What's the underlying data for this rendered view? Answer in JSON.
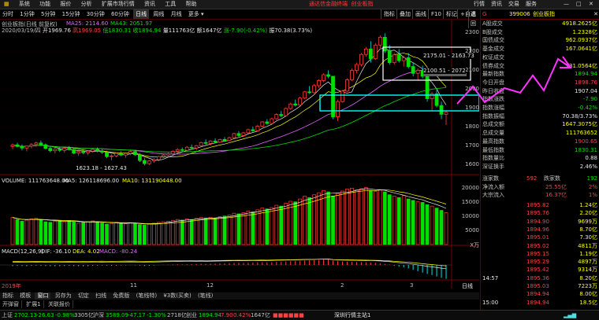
{
  "menu": {
    "items": [
      "系统",
      "功能",
      "报价",
      "分析",
      "扩展市场行情",
      "资讯",
      "工具",
      "帮助"
    ],
    "center_links": [
      "通达信金融终端",
      "创业板指"
    ],
    "window_buttons": [
      "行",
      "情",
      "资",
      "讯",
      "交",
      "易",
      "服",
      "务"
    ]
  },
  "toolbar": {
    "timeframes": [
      "分时",
      "1分钟",
      "5分钟",
      "15分钟",
      "30分钟",
      "60分钟",
      "日线",
      "周线",
      "月线",
      "更多"
    ],
    "active": "日线",
    "right_buttons": [
      "指标",
      "叠加",
      "画线",
      "F10",
      "标记",
      "+自选",
      "返回"
    ]
  },
  "chart": {
    "title_line": "创业板指(日线 前复权)",
    "ma_line": [
      {
        "text": "MA25: 2114.60",
        "color": "#e066ff"
      },
      {
        "text": "MA43: 2051.97",
        "color": "#00e000"
      }
    ],
    "date_line": "2020/03/19/四",
    "ohlc_line": [
      {
        "text": "开1969.76",
        "color": "#e6e6e6"
      },
      {
        "text": "高1969.05",
        "color": "#ff4040"
      },
      {
        "text": "低1830.31",
        "color": "#00e000"
      },
      {
        "text": "收1894.94",
        "color": "#00e000"
      },
      {
        "text": "量111763亿",
        "color": "#e6e6e6"
      },
      {
        "text": "额1647亿",
        "color": "#e6e6e6"
      },
      {
        "text": "涨-7.90(-0.42%)",
        "color": "#00e000"
      },
      {
        "text": "振70.38(3.73%)",
        "color": "#e6e6e6"
      }
    ],
    "price_axis": [
      "2300",
      "2200",
      "2100",
      "2000",
      "1900",
      "1800",
      "1700",
      "1600"
    ],
    "annotations": {
      "range1": "2175.01 - 2163.73",
      "range2": "2100.51 - 2072",
      "low_label": "1623.18 - 1627.43"
    },
    "volume_title": "VOLUME: 111763648.00",
    "volume_ma5": "MA5: 126118696.00",
    "volume_ma10": "MA10: 131190448.00",
    "volume_axis": [
      "20000",
      "15000",
      "10000",
      "5000"
    ],
    "volume_unit": "X万",
    "macd_title": "MACD(12,26,9)",
    "macd_dif": "DIF: -36.10",
    "macd_dea": "DEA: 4.02",
    "macd_val": "MACD: -80.24",
    "date_axis": [
      "2019年",
      "11",
      "12",
      "2",
      "3"
    ],
    "period_label": "日线"
  },
  "chart_data": {
    "type": "candlestick",
    "ylim": [
      1580,
      2330
    ],
    "candles": [
      [
        1720,
        1735,
        1705,
        1728
      ],
      [
        1728,
        1740,
        1715,
        1720
      ],
      [
        1720,
        1730,
        1700,
        1712
      ],
      [
        1712,
        1725,
        1695,
        1722
      ],
      [
        1722,
        1738,
        1710,
        1730
      ],
      [
        1730,
        1745,
        1718,
        1738
      ],
      [
        1738,
        1750,
        1725,
        1729
      ],
      [
        1729,
        1735,
        1705,
        1710
      ],
      [
        1710,
        1722,
        1690,
        1698
      ],
      [
        1698,
        1712,
        1685,
        1706
      ],
      [
        1706,
        1718,
        1692,
        1700
      ],
      [
        1700,
        1715,
        1688,
        1711
      ],
      [
        1711,
        1722,
        1700,
        1704
      ],
      [
        1704,
        1712,
        1680,
        1686
      ],
      [
        1686,
        1700,
        1672,
        1694
      ],
      [
        1694,
        1706,
        1680,
        1688
      ],
      [
        1688,
        1700,
        1675,
        1696
      ],
      [
        1696,
        1712,
        1688,
        1705
      ],
      [
        1705,
        1715,
        1690,
        1697
      ],
      [
        1697,
        1706,
        1682,
        1690
      ],
      [
        1690,
        1698,
        1660,
        1668
      ],
      [
        1668,
        1680,
        1650,
        1672
      ],
      [
        1672,
        1690,
        1665,
        1685
      ],
      [
        1685,
        1695,
        1670,
        1676
      ],
      [
        1676,
        1690,
        1662,
        1684
      ],
      [
        1684,
        1700,
        1676,
        1694
      ],
      [
        1694,
        1702,
        1672,
        1678
      ],
      [
        1678,
        1686,
        1640,
        1648
      ],
      [
        1648,
        1660,
        1623,
        1632
      ],
      [
        1632,
        1650,
        1625,
        1646
      ],
      [
        1646,
        1660,
        1636,
        1652
      ],
      [
        1652,
        1672,
        1645,
        1668
      ],
      [
        1668,
        1684,
        1660,
        1676
      ],
      [
        1676,
        1690,
        1668,
        1682
      ],
      [
        1682,
        1700,
        1675,
        1695
      ],
      [
        1695,
        1712,
        1688,
        1704
      ],
      [
        1704,
        1715,
        1692,
        1700
      ],
      [
        1700,
        1722,
        1695,
        1716
      ],
      [
        1716,
        1730,
        1705,
        1712
      ],
      [
        1712,
        1728,
        1700,
        1724
      ],
      [
        1724,
        1745,
        1718,
        1740
      ],
      [
        1740,
        1756,
        1730,
        1736
      ],
      [
        1736,
        1752,
        1725,
        1748
      ],
      [
        1748,
        1762,
        1735,
        1742
      ],
      [
        1742,
        1760,
        1738,
        1756
      ],
      [
        1756,
        1768,
        1745,
        1750
      ],
      [
        1750,
        1770,
        1745,
        1765
      ],
      [
        1765,
        1790,
        1760,
        1786
      ],
      [
        1786,
        1798,
        1770,
        1776
      ],
      [
        1776,
        1795,
        1770,
        1790
      ],
      [
        1790,
        1812,
        1785,
        1806
      ],
      [
        1806,
        1822,
        1795,
        1800
      ],
      [
        1800,
        1830,
        1796,
        1824
      ],
      [
        1824,
        1850,
        1818,
        1846
      ],
      [
        1846,
        1860,
        1832,
        1838
      ],
      [
        1838,
        1868,
        1834,
        1862
      ],
      [
        1862,
        1890,
        1856,
        1884
      ],
      [
        1884,
        1902,
        1870,
        1878
      ],
      [
        1878,
        1920,
        1875,
        1915
      ],
      [
        1915,
        1945,
        1908,
        1938
      ],
      [
        1938,
        1960,
        1925,
        1932
      ],
      [
        1932,
        1975,
        1928,
        1968
      ],
      [
        1968,
        2005,
        1962,
        2000
      ],
      [
        2000,
        2030,
        1990,
        1996
      ],
      [
        1996,
        2040,
        1992,
        2032
      ],
      [
        2032,
        2065,
        2020,
        2058
      ],
      [
        2058,
        2095,
        2050,
        2088
      ],
      [
        2088,
        2110,
        2070,
        2080
      ],
      [
        2080,
        2075,
        1860,
        1872
      ],
      [
        1872,
        1960,
        1850,
        1950
      ],
      [
        1950,
        2010,
        1945,
        2004
      ],
      [
        2004,
        2070,
        2000,
        2062
      ],
      [
        2062,
        2120,
        2055,
        2110
      ],
      [
        2110,
        2150,
        2095,
        2140
      ],
      [
        2140,
        2200,
        2130,
        2192
      ],
      [
        2192,
        2230,
        2180,
        2220
      ],
      [
        2220,
        2260,
        2150,
        2170
      ],
      [
        2170,
        2250,
        2165,
        2240
      ],
      [
        2240,
        2290,
        2225,
        2280
      ],
      [
        2280,
        2300,
        2200,
        2210
      ],
      [
        2210,
        2240,
        2140,
        2150
      ],
      [
        2150,
        2200,
        2140,
        2190
      ],
      [
        2190,
        2220,
        2150,
        2160
      ],
      [
        2160,
        2185,
        2130,
        2175
      ],
      [
        2175,
        2200,
        2120,
        2130
      ],
      [
        2130,
        2150,
        2080,
        2095
      ],
      [
        2095,
        2120,
        2060,
        2110
      ],
      [
        2110,
        2135,
        2070,
        2080
      ],
      [
        2080,
        2100,
        1950,
        1965
      ],
      [
        1965,
        2000,
        1900,
        1990
      ],
      [
        1990,
        2010,
        1920,
        1930
      ],
      [
        1930,
        1950,
        1860,
        1885
      ],
      [
        1885,
        1905,
        1830,
        1895
      ]
    ],
    "volume": [
      95,
      88,
      82,
      86,
      90,
      92,
      87,
      80,
      78,
      82,
      85,
      80,
      84,
      79,
      75,
      77,
      80,
      83,
      79,
      76,
      72,
      74,
      78,
      75,
      73,
      76,
      74,
      70,
      68,
      72,
      75,
      78,
      80,
      82,
      85,
      88,
      86,
      90,
      88,
      92,
      95,
      93,
      96,
      92,
      98,
      100,
      104,
      110,
      108,
      112,
      118,
      115,
      122,
      128,
      125,
      130,
      138,
      135,
      145,
      152,
      150,
      160,
      170,
      165,
      175,
      182,
      190,
      185,
      170,
      180,
      188,
      195,
      198,
      192,
      196,
      200,
      190,
      186,
      192,
      185,
      175,
      170,
      165,
      172,
      160,
      155,
      150,
      148,
      140,
      135,
      128,
      120,
      112
    ],
    "macd": [
      -6,
      -5,
      -6,
      -7,
      -5,
      -4,
      -5,
      -6,
      -7,
      -8,
      -7,
      -6,
      -5,
      -6,
      -7,
      -8,
      -7,
      -5,
      -4,
      -3,
      -4,
      -5,
      -4,
      -3,
      -2,
      -1,
      -2,
      -4,
      -6,
      -5,
      -3,
      -1,
      1,
      2,
      3,
      4,
      3,
      4,
      5,
      6,
      7,
      6,
      7,
      8,
      9,
      10,
      11,
      12,
      13,
      12,
      13,
      14,
      15,
      16,
      15,
      16,
      18,
      19,
      20,
      22,
      23,
      24,
      26,
      27,
      28,
      30,
      31,
      32,
      25,
      22,
      20,
      19,
      18,
      17,
      16,
      15,
      14,
      12,
      10,
      6,
      2,
      -4,
      -10,
      -14,
      -20,
      -28,
      -36,
      -44,
      -52,
      -58,
      -66,
      -74,
      -80
    ]
  },
  "panel": {
    "code": "399006",
    "name": "创业板指",
    "stats": [
      {
        "k": "A股成交",
        "v": "4918.2625亿",
        "c": "yel"
      },
      {
        "k": "B股成交",
        "v": "1.2328亿",
        "c": "yel"
      },
      {
        "k": "国债成交",
        "v": "962.0937亿",
        "c": "yel"
      },
      {
        "k": "基金成交",
        "v": "167.0641亿",
        "c": "yel"
      },
      {
        "k": "权证成交",
        "v": "",
        "c": "yel"
      },
      {
        "k": "债券成交",
        "v": "131.0564亿",
        "c": "yel"
      },
      {
        "k": "最新指数",
        "v": "1894.94",
        "c": "grn"
      },
      {
        "k": "今日开盘",
        "v": "1898.76",
        "c": "red"
      },
      {
        "k": "昨日收盘",
        "v": "1907.04",
        "c": "wht"
      },
      {
        "k": "指数涨跌",
        "v": "-7.90",
        "c": "grn"
      },
      {
        "k": "指数涨幅",
        "v": "-0.42%",
        "c": "grn"
      },
      {
        "k": "指数振幅",
        "v": "70.38/3.73%",
        "c": "wht"
      },
      {
        "k": "总成交额",
        "v": "1647.3075亿",
        "c": "yel"
      },
      {
        "k": "总成交量",
        "v": "111763652",
        "c": "yel"
      },
      {
        "k": "最高指数",
        "v": "1900.65",
        "c": "red"
      },
      {
        "k": "最低指数",
        "v": "1830.31",
        "c": "grn"
      },
      {
        "k": "指数量比",
        "v": "0.88",
        "c": "wht"
      },
      {
        "k": "深证换手",
        "v": "2.46%",
        "c": "wht"
      }
    ],
    "updown": {
      "up_label": "涨家数",
      "up_val": "592",
      "down_label": "跌家数",
      "down_val": "192"
    },
    "flows": [
      {
        "k": "净流入额",
        "v": "25.55亿",
        "p": "2%"
      },
      {
        "k": "大宗流入",
        "v": "16.37亿",
        "p": "1%"
      }
    ],
    "ticks": [
      {
        "t": "",
        "p": "1895.82",
        "v": "1.24亿"
      },
      {
        "t": "",
        "p": "1895.76",
        "v": "2.20亿"
      },
      {
        "t": "",
        "p": "1894.90",
        "v": "9699万"
      },
      {
        "t": "",
        "p": "1894.96",
        "v": "8.70亿"
      },
      {
        "t": "",
        "p": "1895.01",
        "v": "7.30亿"
      },
      {
        "t": "",
        "p": "1895.02",
        "v": "4811万"
      },
      {
        "t": "",
        "p": "1895.15",
        "v": "1.19亿"
      },
      {
        "t": "",
        "p": "1895.29",
        "v": "4897万"
      },
      {
        "t": "",
        "p": "1895.42",
        "v": "9314万"
      },
      {
        "t": "14:57",
        "p": "1895.36",
        "v": "8.20亿"
      },
      {
        "t": "",
        "p": "1895.03",
        "v": "7223万"
      },
      {
        "t": "",
        "p": "1894.94",
        "v": "8.00亿"
      },
      {
        "t": "15:00",
        "p": "1894.94",
        "v": "18.5亿"
      }
    ]
  },
  "tabs1": [
    "指标",
    "模板",
    "窗口",
    "另存为",
    "切定",
    "扫线",
    "免费版",
    "(笔线特)",
    "¥3数(买卖)",
    "(笔线)"
  ],
  "tabs1_active": "窗口",
  "tabs2": [
    "开弹窗",
    "扩展1",
    "关联报价"
  ],
  "status": {
    "sh_label": "上证",
    "sh_val": "2702.13",
    "sh_chg": "-26.63",
    "sh_pct": "-0.98%",
    "sh_amt": "3305亿",
    "hs_label": "沪深",
    "hs_val": "3589.09",
    "hs_chg": "-47.17",
    "hs_pct": "-1.30%",
    "hs_amt": "2718亿",
    "cy_label": "创业",
    "cy_val": "1894.94",
    "cy_chg": "7.90",
    "cy_pct": "0.42%",
    "cy_amt": "1647亿",
    "server": "深圳行情主站1"
  }
}
